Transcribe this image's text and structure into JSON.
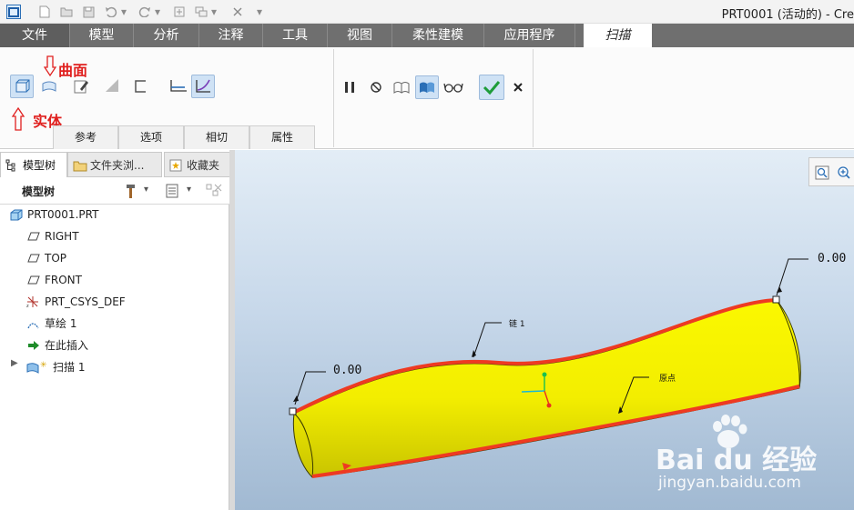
{
  "window": {
    "title": "PRT0001 (活动的) - Cre"
  },
  "ribbon_tabs": [
    "文件",
    "模型",
    "分析",
    "注释",
    "工具",
    "视图",
    "柔性建模",
    "应用程序",
    "扫描"
  ],
  "sweep_subtabs": [
    "参考",
    "选项",
    "相切",
    "属性"
  ],
  "annotations": {
    "surface": "曲面",
    "solid": "实体"
  },
  "panel_tabs": [
    "模型树",
    "文件夹浏...",
    "收藏夹"
  ],
  "model_tree": {
    "header": "模型树",
    "items": [
      {
        "label": "PRT0001.PRT",
        "icon": "part-icon"
      },
      {
        "label": "RIGHT",
        "icon": "datum-plane-icon"
      },
      {
        "label": "TOP",
        "icon": "datum-plane-icon"
      },
      {
        "label": "FRONT",
        "icon": "datum-plane-icon"
      },
      {
        "label": "PRT_CSYS_DEF",
        "icon": "coordinate-system-icon"
      },
      {
        "label": "草绘 1",
        "icon": "sketch-icon"
      },
      {
        "label": "在此插入",
        "icon": "insert-here-arrow-icon"
      },
      {
        "label": "扫描 1",
        "icon": "sweep-feature-icon"
      }
    ]
  },
  "viewport": {
    "dim_left": "0.00",
    "dim_right": "0.00",
    "label_chain": "链 1",
    "label_origin": "原点"
  },
  "watermark": {
    "brand": "Bai du 经验",
    "url": "jingyan.baidu.com"
  },
  "colors": {
    "surface": "#f5f000",
    "trajectory": "#ee3a22",
    "accent": "#2b6fb6",
    "confirm": "#1e9c3a"
  }
}
